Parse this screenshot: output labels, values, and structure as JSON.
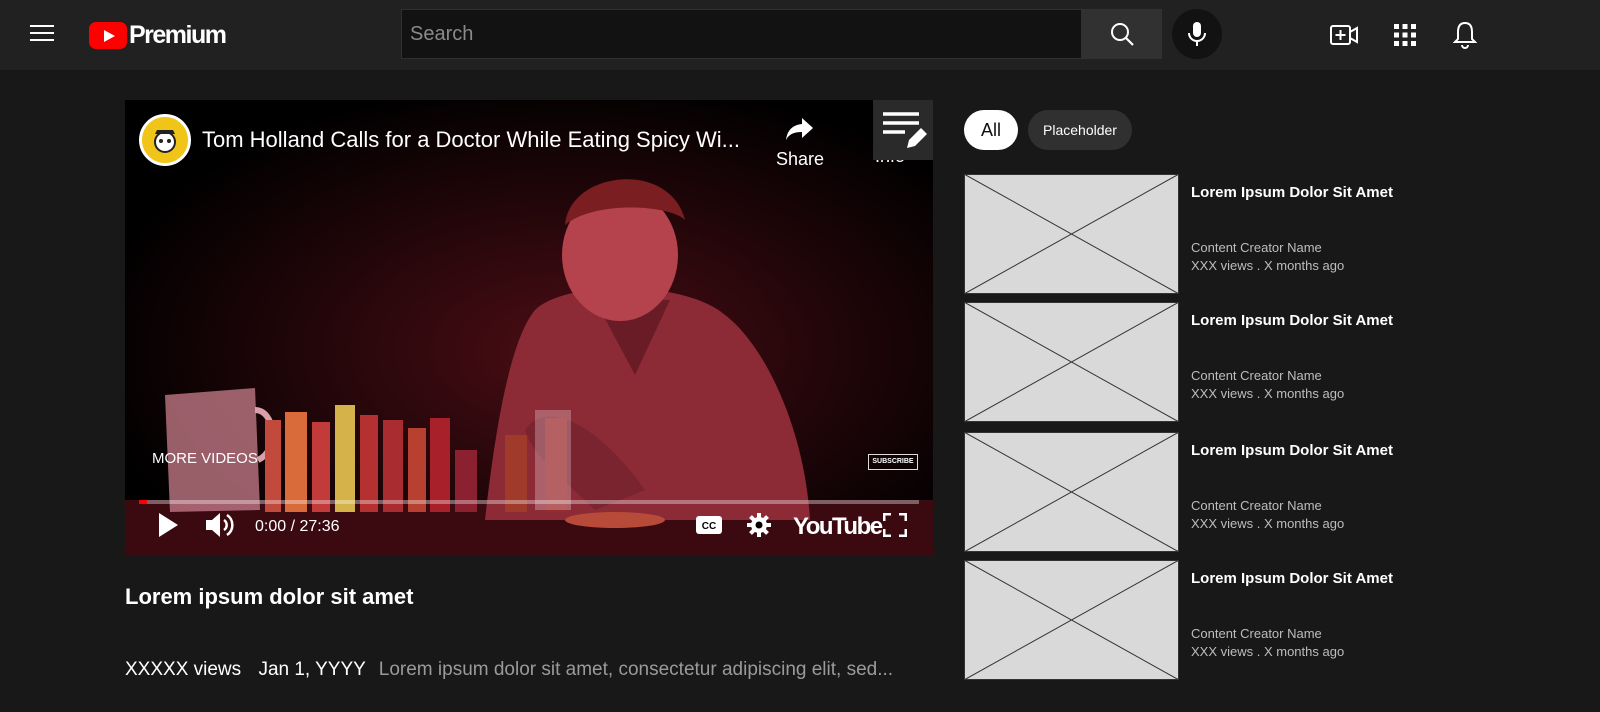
{
  "header": {
    "logo_text": "Premium",
    "search_placeholder": "Search"
  },
  "player": {
    "title": "Tom Holland Calls for a Doctor While Eating Spicy Wi...",
    "share_label": "Share",
    "info_label": "Info",
    "more_videos_label": "MORE VIDEOS",
    "subscribe_label": "SUBSCRIBE",
    "time": "0:00 / 27:36",
    "progress_fraction": 0.01,
    "brand_wordmark": "YouTube"
  },
  "video": {
    "title": "Lorem ipsum dolor sit amet",
    "views": "XXXXX views",
    "date": "Jan 1, YYYY",
    "description": "Lorem ipsum dolor sit amet, consectetur adipiscing elit, sed..."
  },
  "chips": [
    {
      "label": "All",
      "selected": true
    },
    {
      "label": "Placeholder",
      "selected": false
    }
  ],
  "recommendations": [
    {
      "title": "Lorem Ipsum Dolor Sit Amet",
      "channel": "Content Creator Name",
      "stats": "XXX views . X months ago"
    },
    {
      "title": "Lorem Ipsum Dolor Sit Amet",
      "channel": "Content Creator Name",
      "stats": "XXX views . X months ago"
    },
    {
      "title": "Lorem Ipsum Dolor Sit Amet",
      "channel": "Content Creator Name",
      "stats": "XXX views . X months ago"
    },
    {
      "title": "Lorem Ipsum Dolor Sit Amet",
      "channel": "Content Creator Name",
      "stats": "XXX views . X months ago"
    }
  ],
  "colors": {
    "background": "#181818",
    "header_bg": "#212121",
    "brand_red": "#ff0000",
    "thumbnail_placeholder": "#d9d9d9"
  },
  "icons": [
    "menu-icon",
    "search-icon",
    "mic-icon",
    "create-video-icon",
    "apps-icon",
    "notifications-icon",
    "share-icon",
    "info-icon",
    "playlist-edit-icon",
    "play-icon",
    "volume-icon",
    "captions-icon",
    "settings-icon",
    "fullscreen-icon"
  ]
}
